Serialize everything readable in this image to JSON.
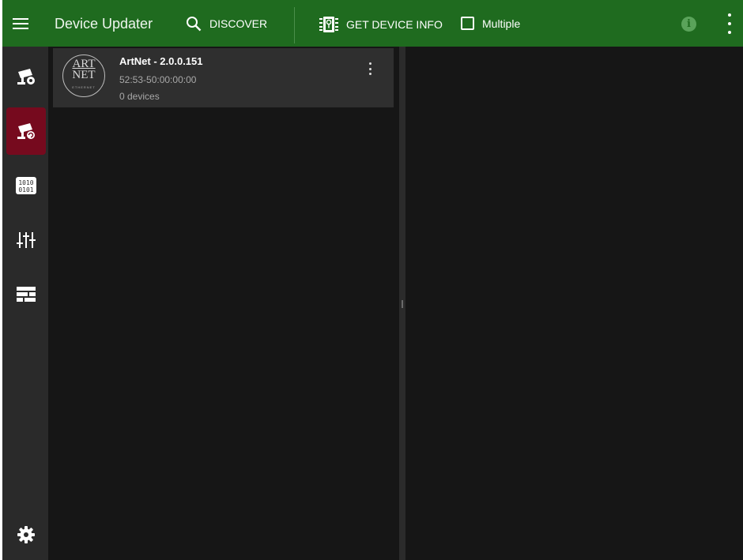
{
  "header": {
    "title": "Device Updater",
    "discover_label": "DISCOVER",
    "get_info_label": "GET DEVICE INFO",
    "multiple_label": "Multiple",
    "multiple_checked": false,
    "info_glyph": "i",
    "icons": [
      "menu-icon",
      "search-icon",
      "chip-info-icon",
      "checkbox-icon",
      "info-icon",
      "more-vert-icon"
    ]
  },
  "sidebar": {
    "items": [
      {
        "icon": "camera-settings-icon",
        "active": false
      },
      {
        "icon": "camera-refresh-icon",
        "active": true
      },
      {
        "icon": "binary-icon",
        "active": false
      },
      {
        "icon": "sliders-icon",
        "active": false
      },
      {
        "icon": "table-rows-icon",
        "active": false
      }
    ],
    "footer_icon": "gear-icon"
  },
  "devices": [
    {
      "name": "ArtNet - 2.0.0.151",
      "mac": "52:53-50:00:00:00",
      "device_count": "0 devices",
      "logo_top": "ART",
      "logo_bottom": "NET",
      "logo_sub": "ETHERNET"
    }
  ],
  "colors": {
    "header_green": "#1f6b1f",
    "active_red": "#760a1e",
    "panel_bg": "#161616",
    "sidebar_bg": "#2a2a2a",
    "card_bg": "#2f2f2f"
  }
}
